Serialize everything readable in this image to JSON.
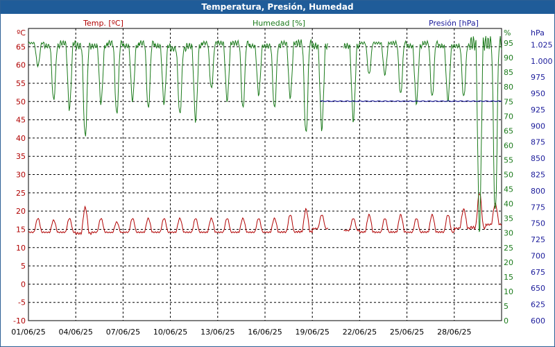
{
  "window": {
    "title": "Temperatura, Presión, Humedad"
  },
  "colors": {
    "temperature": "#b00000",
    "humidity": "#1a7a1a",
    "pressure": "#1a1a9a",
    "grid": "#000000",
    "title_bg": "#1f5c99"
  },
  "chart_data": {
    "type": "line",
    "title": "Temperatura, Presión, Humedad",
    "grid": true,
    "x_tick_labels": [
      "01/06/25",
      "04/06/25",
      "07/06/25",
      "10/06/25",
      "13/06/25",
      "16/06/25",
      "19/06/25",
      "22/06/25",
      "25/06/25",
      "28/06/25"
    ],
    "x_range": [
      1,
      31
    ],
    "axes": {
      "left": {
        "label": "Temp. [ºC]",
        "unit": "ºC",
        "range": [
          -10,
          70
        ],
        "ticks": [
          -10,
          -5,
          0,
          5,
          10,
          15,
          20,
          25,
          30,
          35,
          40,
          45,
          50,
          55,
          60,
          65
        ]
      },
      "right1": {
        "label": "Humedad [%]",
        "unit": "%",
        "range": [
          0,
          100
        ],
        "ticks": [
          0,
          5,
          10,
          15,
          20,
          25,
          30,
          35,
          40,
          45,
          50,
          55,
          60,
          65,
          70,
          75,
          80,
          85,
          90,
          95
        ]
      },
      "right2": {
        "label": "Presión [hPa]",
        "unit": "hPa",
        "range": [
          600,
          1050
        ],
        "ticks": [
          "600",
          "625",
          "650",
          "675",
          "700",
          "725",
          "750",
          "775",
          "800",
          "825",
          "850",
          "875",
          "900",
          "925",
          "950",
          "975",
          "1.000",
          "1.025"
        ]
      }
    },
    "series": [
      {
        "name": "Temp. [ºC]",
        "axis": "left",
        "daily_min": [
          14,
          14,
          14,
          13.5,
          14,
          14,
          14,
          14,
          14,
          14,
          14,
          14,
          14,
          14,
          14,
          14,
          14,
          14,
          15,
          null,
          14.5,
          14,
          14,
          14,
          14,
          14,
          14,
          15,
          15,
          16
        ],
        "daily_max": [
          18,
          17.5,
          18,
          21,
          18,
          17,
          18,
          18,
          18,
          18,
          18,
          18,
          18,
          18,
          18,
          18,
          19,
          20.5,
          19,
          null,
          18,
          19,
          18,
          19,
          18,
          19,
          19,
          20.5,
          25,
          22
        ]
      },
      {
        "name": "Humedad [%]",
        "axis": "right1",
        "daily_min": [
          87,
          75,
          72,
          62,
          74,
          70,
          75,
          72,
          74,
          70,
          68,
          79,
          75,
          72,
          77,
          72,
          76,
          63,
          65,
          null,
          68,
          84,
          84,
          77,
          74,
          76,
          75,
          76,
          30,
          35
        ],
        "daily_max": [
          95,
          94,
          95,
          94,
          94,
          95,
          94,
          95,
          94,
          93,
          94,
          95,
          95,
          95,
          94,
          94,
          95,
          95,
          94,
          null,
          94,
          95,
          95,
          95,
          94,
          95,
          94,
          94,
          95,
          95
        ]
      },
      {
        "name": "Presión [hPa]",
        "axis": "right2",
        "x": [
          19.5,
          31
        ],
        "values": [
          938,
          938
        ]
      }
    ]
  }
}
